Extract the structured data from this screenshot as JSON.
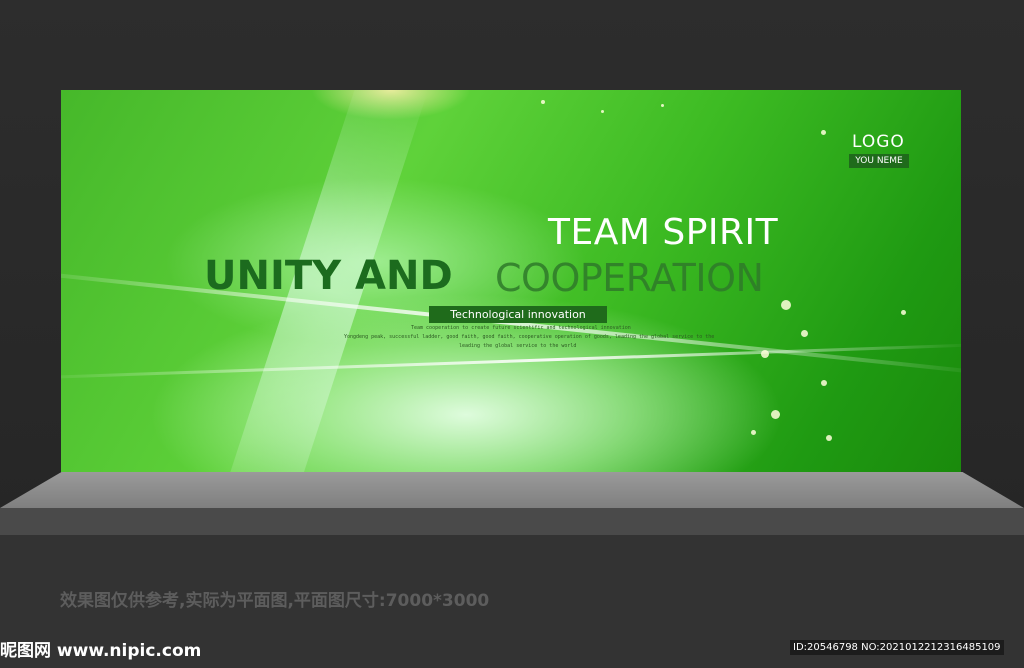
{
  "banner": {
    "logo": "LOGO",
    "logo_sub": "YOU NEME",
    "headline_top": "TEAM SPIRIT",
    "headline_bold": "UNITY AND",
    "headline_light": "COOPERATION",
    "tag": "Technological innovation",
    "small_lines": [
      "Team cooperation to create future scientific and technological innovation",
      "Yongdeng peak, successful ladder, good faith, good faith, cooperative operation of goods, leading the global service to the",
      "leading the global service to the world"
    ]
  },
  "caption": "效果图仅供参考,实际为平面图,平面图尺寸:7000*3000",
  "watermark": {
    "left": "昵图网 www.nipic.com",
    "right": "ID:20546798 NO:20210122123164851​09"
  }
}
